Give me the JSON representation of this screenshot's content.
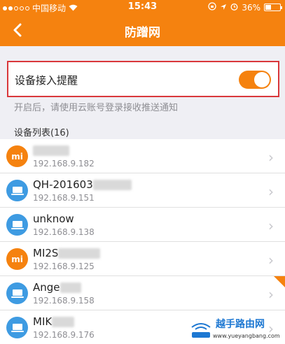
{
  "statusbar": {
    "carrier": "中国移动",
    "time": "15:43",
    "battery": "36%"
  },
  "navbar": {
    "title": "防蹭网",
    "back_icon": "‹"
  },
  "toggle": {
    "label": "设备接入提醒",
    "on": true
  },
  "hint": "开启后，请使用云账号登录接收推送通知",
  "list_header": "设备列表(16)",
  "devices": [
    {
      "type": "mi",
      "name": "",
      "ip": "192.168.9.182",
      "icon": "mi-icon"
    },
    {
      "type": "laptop",
      "name": "QH-201603",
      "ip": "192.168.9.151",
      "icon": "laptop-icon"
    },
    {
      "type": "laptop",
      "name": "unknow",
      "ip": "192.168.9.138",
      "icon": "laptop-icon"
    },
    {
      "type": "mi",
      "name": "MI2S",
      "ip": "192.168.9.125",
      "icon": "mi-icon"
    },
    {
      "type": "laptop",
      "name": "Ange",
      "ip": "192.168.9.158",
      "icon": "laptop-icon"
    },
    {
      "type": "laptop",
      "name": "MIK",
      "ip": "192.168.9.176",
      "icon": "laptop-icon"
    }
  ],
  "mi_label": "mi",
  "watermark": {
    "title": "越手路由网",
    "url": "www.yueyangbang.com"
  },
  "colors": {
    "accent": "#f5820f",
    "highlight_border": "#d9373b",
    "laptop_icon_bg": "#3e9be2"
  }
}
